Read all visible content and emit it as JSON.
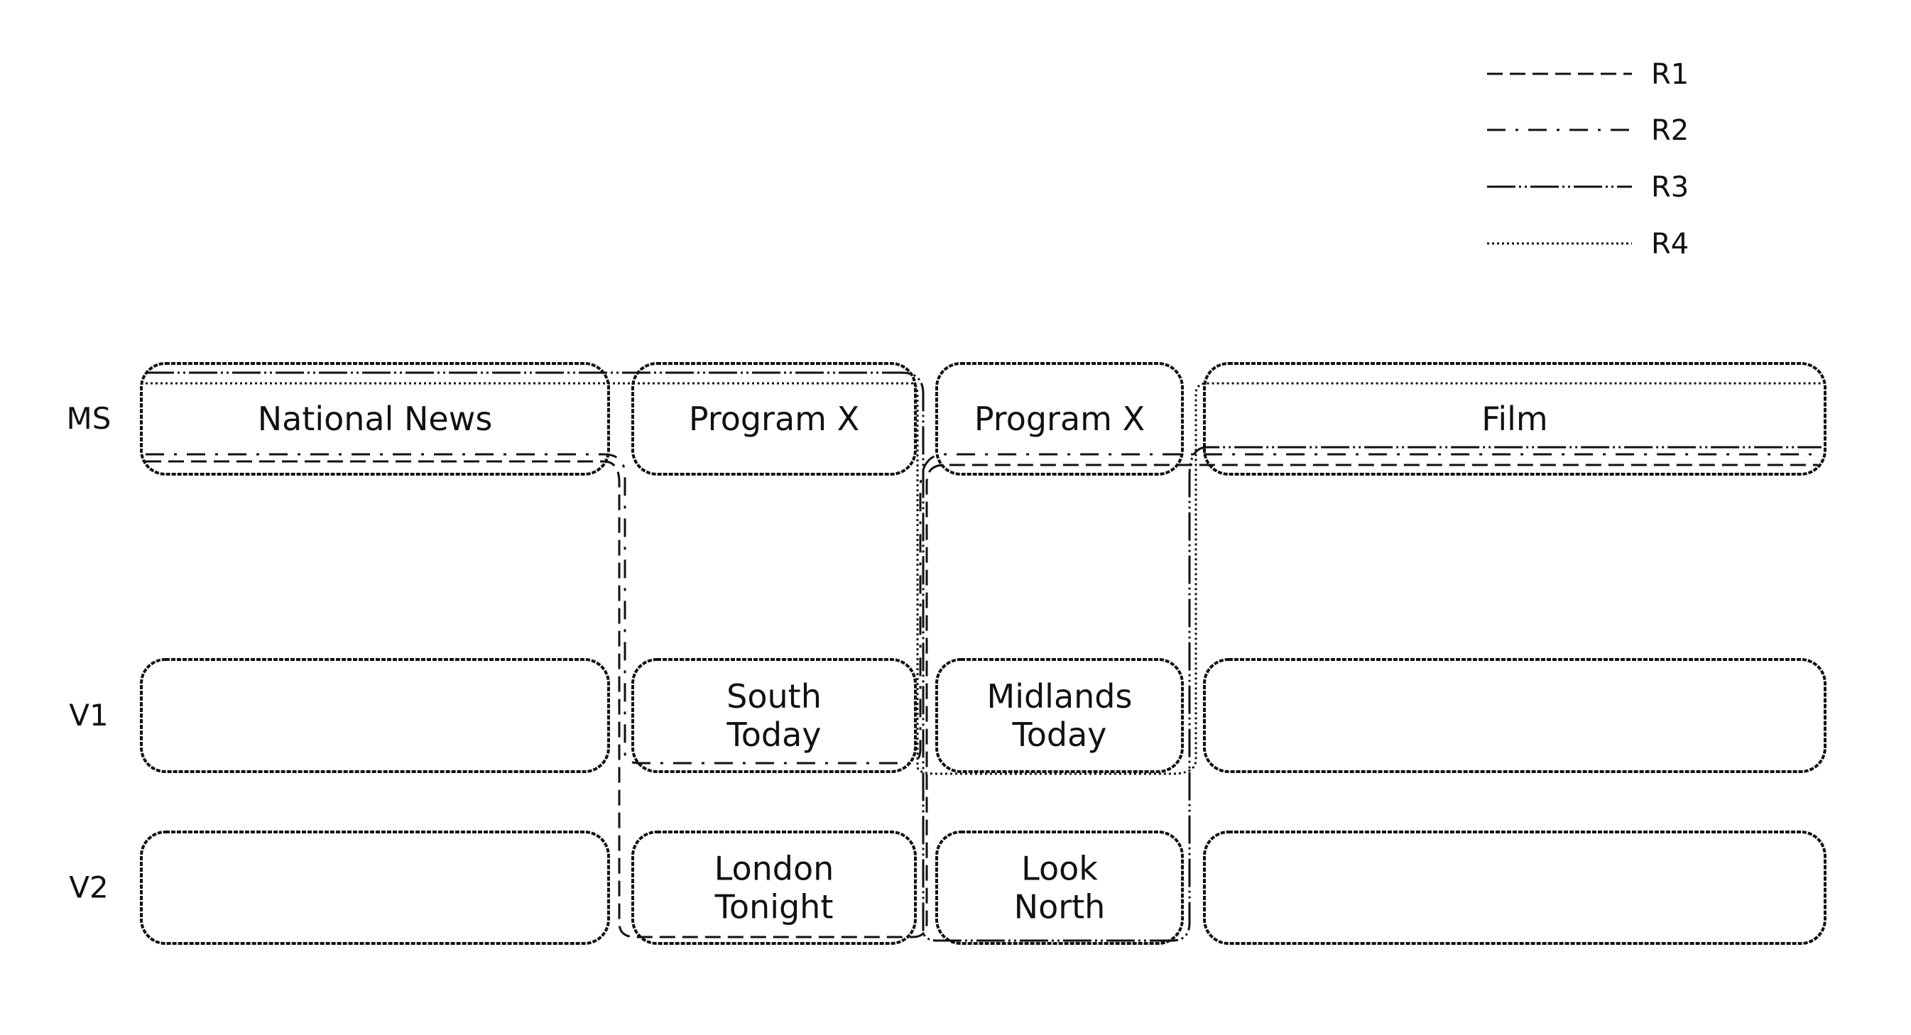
{
  "legend": [
    {
      "id": "R1",
      "label": "R1",
      "style": "dashed"
    },
    {
      "id": "R2",
      "label": "R2",
      "style": "dash-dot"
    },
    {
      "id": "R3",
      "label": "R3",
      "style": "long-dash-dot-dot"
    },
    {
      "id": "R4",
      "label": "R4",
      "style": "dotted"
    }
  ],
  "rows": [
    {
      "id": "MS",
      "label": "MS"
    },
    {
      "id": "V1",
      "label": "V1"
    },
    {
      "id": "V2",
      "label": "V2"
    }
  ],
  "cells": {
    "MS": [
      "National News",
      "Program X",
      "Program X",
      "Film"
    ],
    "V1": [
      "",
      "South Today",
      "Midlands Today",
      ""
    ],
    "V2": [
      "",
      "London Tonight",
      "Look North",
      ""
    ]
  },
  "routes": {
    "R1": [
      "National News",
      "London Tonight",
      "Program X",
      "Film"
    ],
    "R2": [
      "National News",
      "South Today",
      "Program X",
      "Film"
    ],
    "R3": [
      "National News",
      "Program X",
      "Look North",
      "Film"
    ],
    "R4": [
      "National News",
      "Program X",
      "Midlands Today",
      "Film"
    ]
  }
}
